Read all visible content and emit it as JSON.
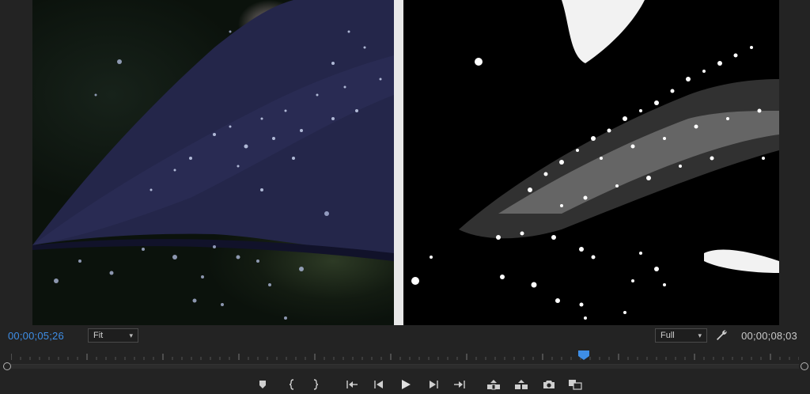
{
  "monitor": {
    "current_timecode": "00;00;05;26",
    "duration_timecode": "00;00;08;03",
    "zoom_select": {
      "value": "Fit"
    },
    "resolution_select": {
      "value": "Full"
    }
  },
  "colors": {
    "accent": "#3e8ee6",
    "panel_bg": "#232323"
  },
  "transport": {
    "buttons": [
      {
        "name": "add-marker-button",
        "icon": "marker-icon"
      },
      {
        "name": "mark-in-button",
        "icon": "mark-in-icon"
      },
      {
        "name": "mark-out-button",
        "icon": "mark-out-icon"
      },
      {
        "name": "go-to-in-button",
        "icon": "go-to-in-icon"
      },
      {
        "name": "step-back-button",
        "icon": "step-back-icon"
      },
      {
        "name": "play-button",
        "icon": "play-icon"
      },
      {
        "name": "step-forward-button",
        "icon": "step-forward-icon"
      },
      {
        "name": "go-to-out-button",
        "icon": "go-to-out-icon"
      },
      {
        "name": "lift-button",
        "icon": "lift-icon"
      },
      {
        "name": "extract-button",
        "icon": "extract-icon"
      },
      {
        "name": "export-frame-button",
        "icon": "camera-icon"
      },
      {
        "name": "comparison-view-button",
        "icon": "comparison-icon"
      }
    ]
  },
  "settings_icon": "wrench-icon"
}
